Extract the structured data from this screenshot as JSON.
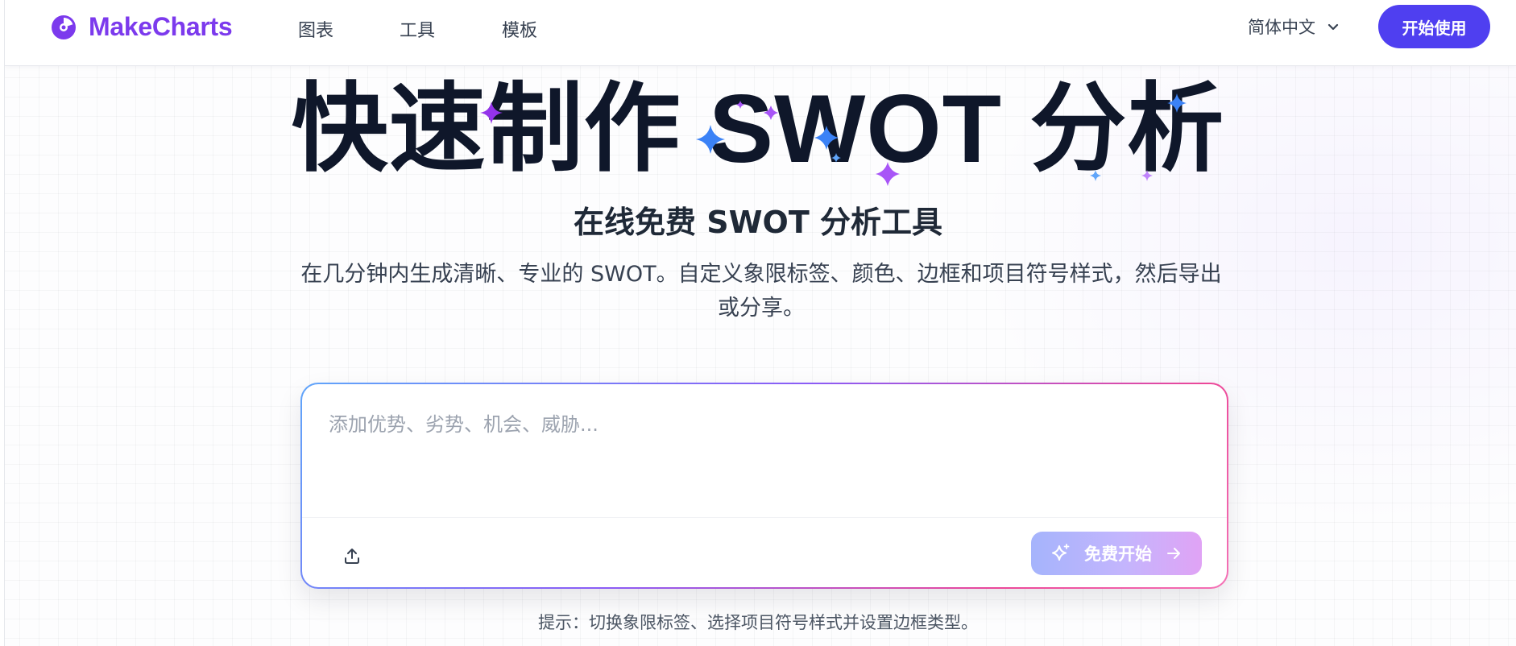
{
  "header": {
    "logo_text": "MakeCharts",
    "nav": [
      "图表",
      "工具",
      "模板"
    ],
    "language": "简体中文",
    "cta_label": "开始使用"
  },
  "hero": {
    "title": "快速制作 SWOT 分析",
    "subtitle": "在线免费 SWOT 分析工具",
    "description": "在几分钟内生成清晰、专业的 SWOT。自定义象限标签、颜色、边框和项目符号样式，然后导出或分享。"
  },
  "input_card": {
    "placeholder": "添加优势、劣势、机会、威胁...",
    "value": "",
    "start_label": "免费开始"
  },
  "hint": "提示：切换象限标签、选择项目符号样式并设置边框类型。",
  "colors": {
    "brand": "#7c3aed",
    "cta": "#4f3ff0",
    "title": "#0f172a",
    "sparkle_blue": "#3b82f6",
    "sparkle_purple": "#a855f7"
  },
  "icons": [
    "logo-icon",
    "chevron-down-icon",
    "sparkle-icon",
    "upload-icon",
    "arrow-right-icon"
  ]
}
